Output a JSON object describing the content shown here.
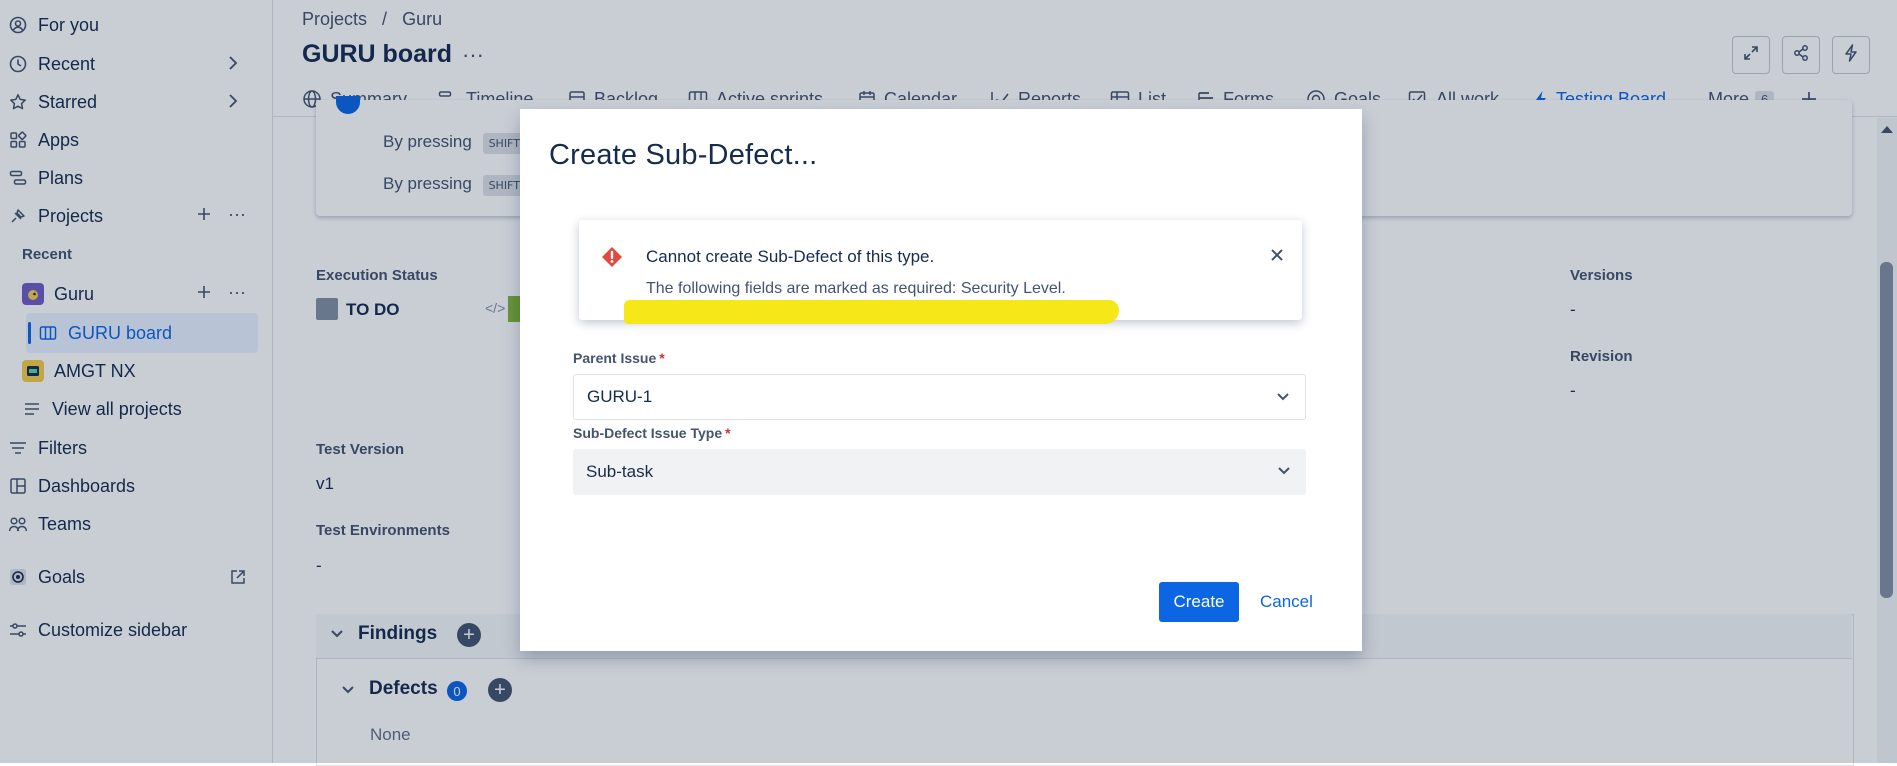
{
  "sidebar": {
    "items": [
      {
        "label": "For you",
        "icon": "user-circle-icon"
      },
      {
        "label": "Recent",
        "icon": "clock-icon"
      },
      {
        "label": "Starred",
        "icon": "star-icon"
      },
      {
        "label": "Apps",
        "icon": "apps-icon"
      },
      {
        "label": "Plans",
        "icon": "plans-icon"
      },
      {
        "label": "Projects",
        "icon": "projects-icon"
      }
    ],
    "recent_label": "Recent",
    "projects": [
      {
        "label": "Guru",
        "icon": "guru-project-avatar"
      },
      {
        "label": "GURU board",
        "icon": "board-icon"
      },
      {
        "label": "AMGT NX",
        "icon": "amgt-project-avatar"
      },
      {
        "label": "View all projects",
        "icon": "list-icon"
      }
    ],
    "bottom_items": [
      {
        "label": "Filters",
        "icon": "filter-icon"
      },
      {
        "label": "Dashboards",
        "icon": "dashboard-icon"
      },
      {
        "label": "Teams",
        "icon": "teams-icon"
      },
      {
        "label": "Goals",
        "icon": "goals-icon"
      },
      {
        "label": "Customize sidebar",
        "icon": "customize-icon"
      }
    ]
  },
  "header": {
    "breadcrumbs": [
      "Projects",
      "/",
      "Guru"
    ],
    "title": "GURU board",
    "more": "···"
  },
  "tabs": [
    {
      "label": "Summary",
      "icon": "globe-icon"
    },
    {
      "label": "Timeline",
      "icon": "timeline-icon"
    },
    {
      "label": "Backlog",
      "icon": "backlog-icon"
    },
    {
      "label": "Active sprints",
      "icon": "board-icon"
    },
    {
      "label": "Calendar",
      "icon": "calendar-icon"
    },
    {
      "label": "Reports",
      "icon": "chart-icon"
    },
    {
      "label": "List",
      "icon": "list-icon"
    },
    {
      "label": "Forms",
      "icon": "forms-icon"
    },
    {
      "label": "Goals",
      "icon": "goals-icon"
    },
    {
      "label": "All work",
      "icon": "all-work-icon"
    },
    {
      "label": "Testing Board",
      "icon": "lightning-icon",
      "active": true
    },
    {
      "label": "More",
      "count": "6"
    }
  ],
  "content": {
    "kbd_prefix": "By pressing",
    "kbd_key": "SHIFT",
    "execution_status_label": "Execution Status",
    "execution_status_value": "TO DO",
    "versions_label": "Versions",
    "versions_value": "-",
    "revision_label": "Revision",
    "revision_value": "-",
    "test_version_label": "Test Version",
    "test_version_value": "v1",
    "test_env_label": "Test Environments",
    "test_env_value": "-",
    "findings_label": "Findings",
    "defects_label": "Defects",
    "defects_count": "0",
    "defects_none": "None"
  },
  "modal": {
    "title": "Create Sub-Defect...",
    "error_title": "Cannot create Sub-Defect of this type.",
    "error_body": "The following fields are marked as required: Security Level.",
    "parent_label": "Parent Issue",
    "parent_value": "GURU-1",
    "type_label": "Sub-Defect Issue Type",
    "type_value": "Sub-task",
    "required_mark": "*",
    "create_label": "Create",
    "cancel_label": "Cancel"
  },
  "colors": {
    "accent": "#0c66e4",
    "error": "#e2483d",
    "highlight": "#f5e60c",
    "status_grey": "#8590a2",
    "status_green": "#82b536"
  }
}
